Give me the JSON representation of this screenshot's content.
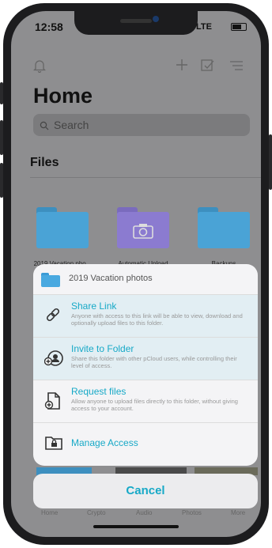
{
  "status": {
    "time": "12:58",
    "network": "LTE"
  },
  "toolbar": {
    "icons": [
      "bell-icon",
      "plus-icon",
      "edit-icon",
      "sort-icon"
    ]
  },
  "page": {
    "title": "Home"
  },
  "search": {
    "placeholder": "Search"
  },
  "files": {
    "heading": "Files",
    "folders": [
      {
        "label": "2019 Vacation pho...",
        "color": "#4aa3d6"
      },
      {
        "label": "Automatic Upload",
        "color": "#8b7bd0"
      },
      {
        "label": "Backups",
        "color": "#4aa3d6"
      }
    ]
  },
  "sheet": {
    "folder_name": "2019 Vacation photos",
    "options": [
      {
        "title": "Share Link",
        "desc": "Anyone with access to this link will be able to view, download and optionally upload files to this folder.",
        "icon": "link-icon"
      },
      {
        "title": "Invite to Folder",
        "desc": "Share this folder with other pCloud users, while controlling their level of access.",
        "icon": "invite-user-icon"
      },
      {
        "title": "Request files",
        "desc": "Allow anyone to upload files directly to this folder, without giving access to your account.",
        "icon": "request-file-icon"
      },
      {
        "title": "Manage Access",
        "desc": "",
        "icon": "folder-lock-icon"
      }
    ],
    "cancel": "Cancel"
  },
  "tabbar": [
    "Home",
    "Crypto",
    "Audio",
    "Photos",
    "More"
  ],
  "colors": {
    "accent": "#17a9c7"
  }
}
